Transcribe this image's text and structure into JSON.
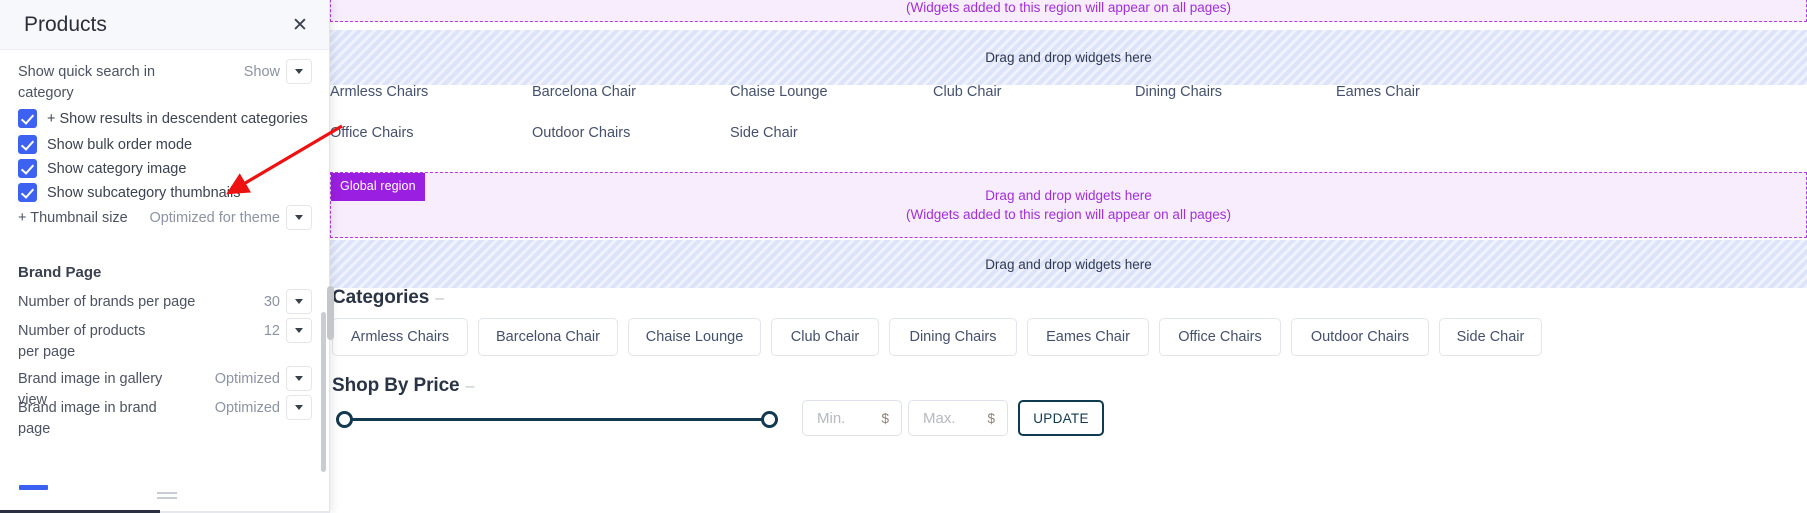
{
  "panel": {
    "title": "Products",
    "close_icon": "close-icon",
    "quick_search": {
      "label": "Show quick search in category",
      "value": "Show"
    },
    "checkboxes": [
      {
        "label": "+ Show results in descendent categories",
        "checked": true
      },
      {
        "label": "Show bulk order mode",
        "checked": true
      },
      {
        "label": "Show category image",
        "checked": true
      },
      {
        "label": "Show subcategory thumbnails",
        "checked": true
      }
    ],
    "thumbnail_size": {
      "label": "+ Thumbnail size",
      "value": "Optimized for theme"
    },
    "brand_page": {
      "title": "Brand Page",
      "rows": [
        {
          "label": "Number of brands per page",
          "value": "30"
        },
        {
          "label": "Number of products per page",
          "value": "12"
        },
        {
          "label": "Brand image in gallery view",
          "value": "Optimized"
        },
        {
          "label": "Brand image in brand page",
          "value": "Optimized"
        }
      ]
    }
  },
  "storefront": {
    "regions": {
      "top_global_note": "(Widgets added to this region will appear on all pages)",
      "drop_text": "Drag and drop widgets here",
      "global_badge": "Global region",
      "global_line1": "Drag and drop widgets here",
      "global_line2": "(Widgets added to this region will appear on all pages)"
    },
    "category_links": [
      "Armless Chairs",
      "Barcelona Chair",
      "Chaise Lounge",
      "Club Chair",
      "Dining Chairs",
      "Eames Chair",
      "Office Chairs",
      "Outdoor Chairs",
      "Side Chair"
    ],
    "categories_section": {
      "heading": "Categories",
      "dash": "–",
      "buttons": [
        "Armless Chairs",
        "Barcelona Chair",
        "Chaise Lounge",
        "Club Chair",
        "Dining Chairs",
        "Eames Chair",
        "Office Chairs",
        "Outdoor Chairs",
        "Side Chair"
      ]
    },
    "shop_by_price": {
      "heading": "Shop By Price",
      "dash": "–",
      "min_placeholder": "Min.",
      "max_placeholder": "Max.",
      "currency": "$",
      "update_label": "UPDATE"
    }
  },
  "colors": {
    "checkbox_blue": "#3d61f0",
    "badge_purple": "#9b1fe0",
    "region_purple_bg": "#f8edfd",
    "region_blue_bg": "#dde4fa",
    "slider_teal": "#12394f",
    "annotation_red": "#ee1111"
  }
}
